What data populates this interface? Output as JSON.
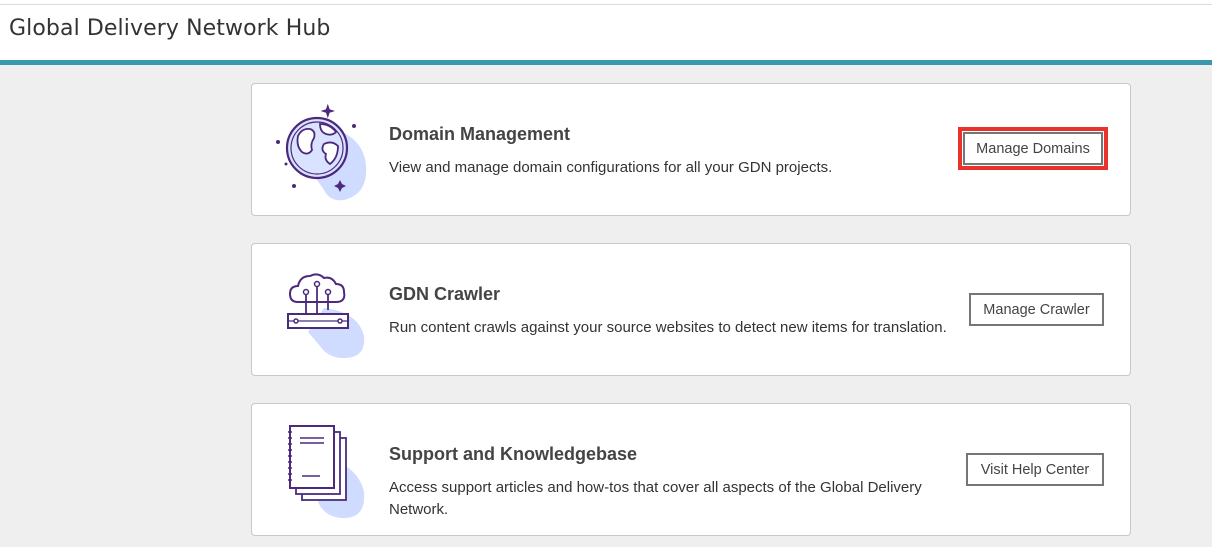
{
  "header": {
    "title": "Global Delivery Network Hub"
  },
  "colors": {
    "accent_bar": "#3a98ad",
    "icon_purple": "#4b2a7e",
    "icon_shadow": "#cfdcff",
    "highlight_red": "#e8322b"
  },
  "cards": [
    {
      "title": "Domain Management",
      "description": "View and manage domain configurations for all your GDN projects.",
      "button_label": "Manage Domains",
      "icon": "globe-icon"
    },
    {
      "title": "GDN Crawler",
      "description": "Run content crawls against your source websites to detect new items for translation.",
      "button_label": "Manage Crawler",
      "icon": "cloud-server-icon"
    },
    {
      "title": "Support and Knowledgebase",
      "description": "Access support articles and how-tos that cover all aspects of the Global Delivery Network.",
      "button_label": "Visit Help Center",
      "icon": "document-stack-icon"
    }
  ]
}
